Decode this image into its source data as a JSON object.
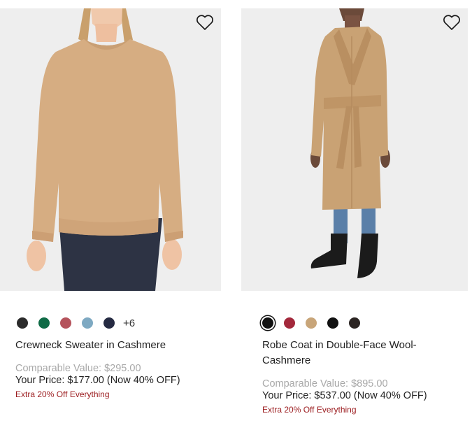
{
  "products": [
    {
      "name": "Crewneck Sweater in Cashmere",
      "comparable_label": "Comparable Value: ",
      "comparable_value": "$295.00",
      "price_label": "Your Price: ",
      "price_value": "$177.00",
      "discount": " (Now 40% OFF)",
      "promo": "Extra 20% Off Everything",
      "swatches": [
        "#2b2b2b",
        "#0f6b46",
        "#b5535c",
        "#7ea9c2",
        "#252a42"
      ],
      "more_colors": "+6",
      "wishlist_icon": "heart-outline-icon"
    },
    {
      "name": "Robe Coat in Double-Face Wool-Cashmere",
      "comparable_label": "Comparable Value: ",
      "comparable_value": "$895.00",
      "price_label": "Your Price: ",
      "price_value": "$537.00",
      "discount": " (Now 40% OFF)",
      "promo": "Extra 20% Off Everything",
      "swatches": [
        "#111111",
        "#a3283b",
        "#c8a579",
        "#111111",
        "#2c2523"
      ],
      "selected_swatch": 0,
      "wishlist_icon": "heart-outline-icon"
    }
  ]
}
